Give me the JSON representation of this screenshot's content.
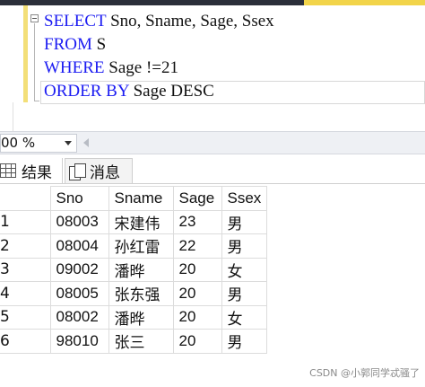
{
  "editor": {
    "lines": [
      {
        "keyword": "SELECT",
        "rest": " Sno, Sname, Sage, Ssex"
      },
      {
        "keyword": "FROM",
        "rest": " S"
      },
      {
        "keyword": "WHERE",
        "rest": " Sage !=21"
      },
      {
        "keyword": "ORDER BY",
        "rest": " Sage DESC"
      }
    ]
  },
  "zoom": {
    "value": "00 %"
  },
  "tabs": {
    "results": "结果",
    "messages": "消息"
  },
  "grid": {
    "columns": [
      "Sno",
      "Sname",
      "Sage",
      "Ssex"
    ],
    "rows": [
      {
        "num": "1",
        "sno": "08003",
        "sname": "宋建伟",
        "sage": "23",
        "ssex": "男"
      },
      {
        "num": "2",
        "sno": "08004",
        "sname": "孙红雷",
        "sage": "22",
        "ssex": "男"
      },
      {
        "num": "3",
        "sno": "09002",
        "sname": "潘晔",
        "sage": "20",
        "ssex": "女"
      },
      {
        "num": "4",
        "sno": "08005",
        "sname": "张东强",
        "sage": "20",
        "ssex": "男"
      },
      {
        "num": "5",
        "sno": "08002",
        "sname": "潘晔",
        "sage": "20",
        "ssex": "女"
      },
      {
        "num": "6",
        "sno": "98010",
        "sname": "张三",
        "sage": "20",
        "ssex": "男"
      }
    ]
  },
  "watermark": "CSDN @小郭同学忒骚了"
}
